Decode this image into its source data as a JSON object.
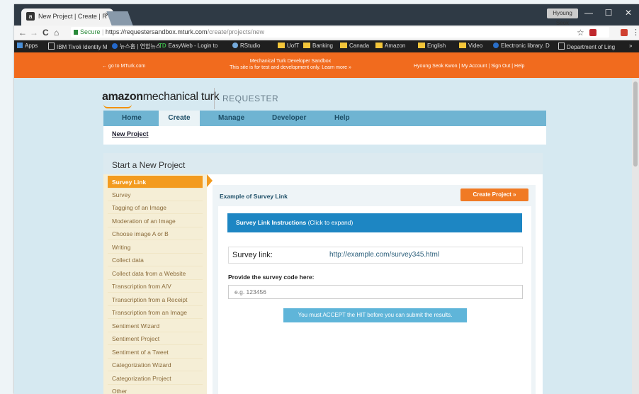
{
  "browser": {
    "tab_title": "New Project | Create | R",
    "tab_close": "✕",
    "profile_name": "Hyoung Seok",
    "controls": {
      "minimize": "—",
      "maximize": "☐",
      "close": "✕"
    },
    "secure_label": "Secure",
    "url_base": "https://requestersandbox.mturk.com",
    "url_path": "/create/projects/new",
    "nav": {
      "back": "←",
      "forward": "→",
      "reload": "C",
      "home": "⌂",
      "star": "☆"
    },
    "bookmarks": [
      "Apps",
      "IBM Tivoli Identity M",
      "뉴스홈 | 연합뉴스",
      "EasyWeb - Login to",
      "RStudio",
      "UofT",
      "Banking",
      "Canada",
      "Amazon",
      "English",
      "Video",
      "Electronic library. D",
      "Department of Ling",
      "»"
    ]
  },
  "banner": {
    "back_link": "← go to MTurk.com",
    "title": "Mechanical Turk Developer Sandbox",
    "notice": "This site is for test and development only. Learn more »",
    "user_links": "Hyoung Seok Kwon | My Account | Sign Out | Help"
  },
  "header": {
    "logo_amazon": "amazon",
    "logo_mt": "mechanical turk",
    "logo_req": "REQUESTER",
    "nav": [
      "Home",
      "Create",
      "Manage",
      "Developer",
      "Help"
    ],
    "active_nav": "Create",
    "subnav_link": "New Project"
  },
  "page": {
    "title": "Start a New Project",
    "templates": [
      "Survey Link",
      "Survey",
      "Tagging of an Image",
      "Moderation of an Image",
      "Choose image A or B",
      "Writing",
      "Collect data",
      "Collect data from a Website",
      "Transcription from A/V",
      "Transcription from a Receipt",
      "Transcription from an Image",
      "Sentiment Wizard",
      "Sentiment Project",
      "Sentiment of a Tweet",
      "Categorization Wizard",
      "Categorization Project",
      "Other"
    ],
    "active_template": "Survey Link",
    "panel_title": "Example of Survey Link",
    "create_button": "Create Project »",
    "instructions_bold": "Survey Link Instructions",
    "instructions_rest": " (Click to expand)",
    "survey_label": "Survey link:",
    "survey_url": "http://example.com/survey345.html",
    "code_label": "Provide the survey code here:",
    "code_placeholder": "e.g. 123456",
    "accept_button": "You must ACCEPT the HIT before you can submit the results."
  }
}
